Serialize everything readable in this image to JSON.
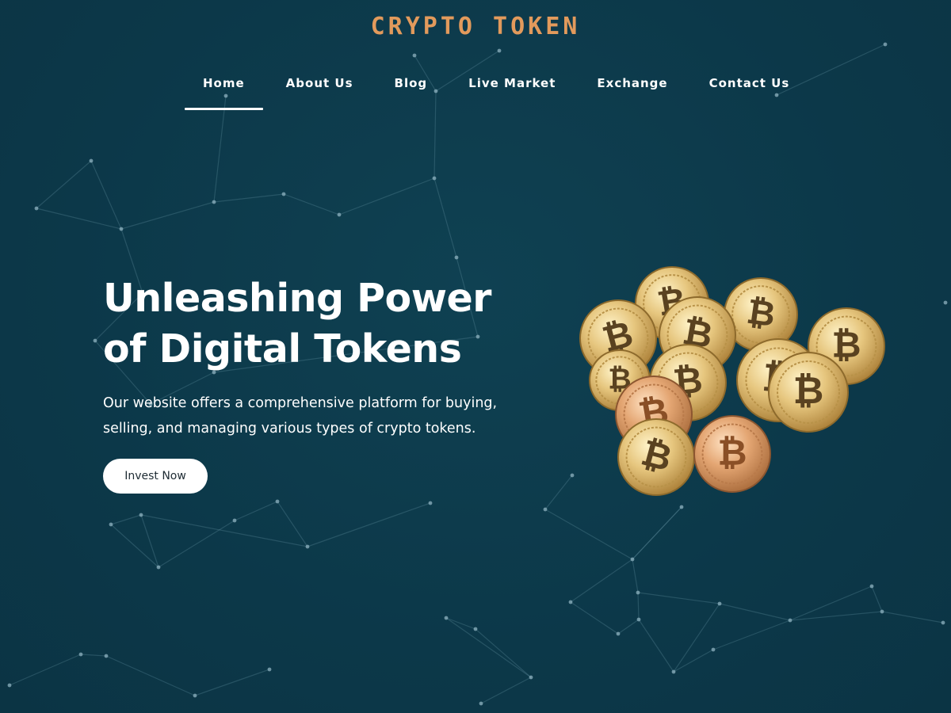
{
  "brand": {
    "name": "CRYPTO TOKEN"
  },
  "nav": {
    "items": [
      {
        "label": "Home",
        "active": true
      },
      {
        "label": "About Us",
        "active": false
      },
      {
        "label": "Blog",
        "active": false
      },
      {
        "label": "Live Market",
        "active": false
      },
      {
        "label": "Exchange",
        "active": false
      },
      {
        "label": "Contact Us",
        "active": false
      }
    ]
  },
  "hero": {
    "title_line1": "Unleashing Power",
    "title_line2": "of Digital Tokens",
    "description": "Our website offers a comprehensive platform for buying, selling, and managing various types of crypto tokens.",
    "cta_label": "Invest Now"
  },
  "illustration": {
    "coin_symbol": "₿",
    "icon": "bitcoin-coins-pile"
  },
  "colors": {
    "background": "#0d3a4b",
    "brand": "#e29a5c",
    "text": "#ffffff",
    "network_line": "#5f8fa0",
    "coin_gold": "#e2c27a"
  }
}
